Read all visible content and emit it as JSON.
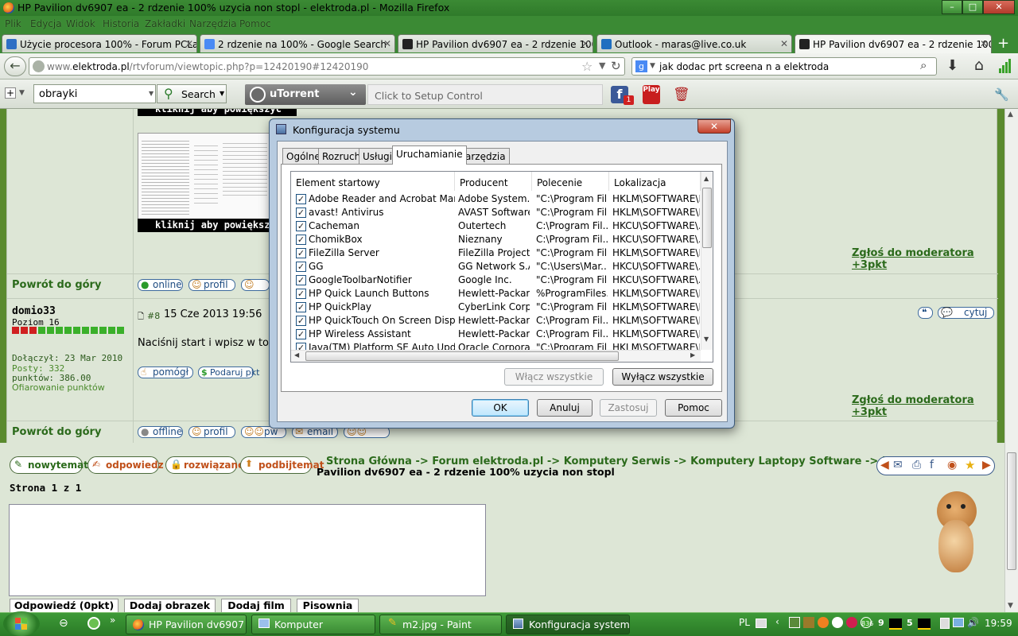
{
  "window": {
    "title": "HP Pavilion dv6907 ea - 2 rdzenie 100% uzycia non stopl - elektroda.pl - Mozilla Firefox",
    "controls": [
      "–",
      "□",
      "✕"
    ]
  },
  "menu": [
    "Plik",
    "Edycja",
    "Widok",
    "Historia",
    "Zakładki",
    "Narzędzia",
    "Pomoc"
  ],
  "tabs": [
    {
      "label": "Użycie procesora 100% - Forum PCLa...",
      "color": "#2e6fc4"
    },
    {
      "label": "2 rdzenie na 100% - Google Search",
      "color": "#4a8af4"
    },
    {
      "label": "HP Pavilion dv6907 ea - 2 rdzenie 100...",
      "color": "#222222"
    },
    {
      "label": "Outlook - maras@live.co.uk",
      "color": "#1f6fc0"
    },
    {
      "label": "HP Pavilion dv6907 ea - 2 rdzenie 100...",
      "color": "#222222"
    }
  ],
  "nav": {
    "url_prefix": "www.",
    "url_domain": "elektroda.pl",
    "url_rest": "/rtvforum/viewtopic.php?p=12420190#12420190",
    "search_value": "jak dodac prt screena n a elektroda"
  },
  "toolbar": {
    "search_field": "obrayki",
    "search_button": "Search",
    "utorrent": "uTorrent",
    "setup_control": "Click to Setup Control",
    "fb_badge": "1",
    "play_label": "Play"
  },
  "forum": {
    "thumb_caption1": "kliknij aby powiększyc",
    "thumb_caption2": "kliknij aby powiększy",
    "back_to_top": "Powrót do góry",
    "report": "Zgłoś do moderatora +3pkt",
    "btn_online": "online",
    "btn_offline": "offline",
    "btn_profile": "profil",
    "btn_pw": "pw",
    "btn_email": "email",
    "post": {
      "author": "domio33",
      "level": "Poziom 16",
      "joined": "Dołączył: 23 Mar 2010",
      "posts": "Posty: 332",
      "points": "punktów: 386.00",
      "donate_points": "Ofiarowanie punktów",
      "num": "#8",
      "date": "15 Cze 2013 19:56",
      "text": "Naciśnij start i wpisz w to p",
      "helped": "pomógł",
      "give_pts": "Podaruj pkt",
      "quote": "cytuj"
    },
    "actions": [
      "nowytemat",
      "odpowiedz",
      "rozwiązano",
      "podbijtemat"
    ],
    "breadcrumb": "Strona Główna -> Forum elektroda.pl -> Komputery Serwis -> Komputery Laptopy Software -> HP",
    "breadcrumb2": "Pavilion dv6907 ea - 2 rdzenie 100% uzycia non stopl",
    "page_info": "Strona 1 z 1",
    "reply_buttons": [
      "Odpowiedź (0pkt)",
      "Dodaj obrazek",
      "Dodaj film",
      "Pisownia"
    ]
  },
  "dialog": {
    "title": "Konfiguracja systemu",
    "tabs": [
      "Ogólne",
      "Rozruch",
      "Usługi",
      "Uruchamianie",
      "Narzędzia"
    ],
    "active_tab": "Uruchamianie",
    "columns": [
      "Element startowy",
      "Producent",
      "Polecenie",
      "Lokalizacja"
    ],
    "rows": [
      [
        "Adobe Reader and Acrobat Manager",
        "Adobe System...",
        "\"C:\\Program Fil...",
        "HKLM\\SOFTWARE\\M..."
      ],
      [
        "avast! Antivirus",
        "AVAST Software",
        "\"C:\\Program Fil...",
        "HKLM\\SOFTWARE\\M..."
      ],
      [
        "Cacheman",
        "Outertech",
        "C:\\Program Fil...",
        "HKCU\\SOFTWARE\\..."
      ],
      [
        "ChomikBox",
        "Nieznany",
        "C:\\Program Fil...",
        "HKCU\\SOFTWARE\\..."
      ],
      [
        "FileZilla Server",
        "FileZilla Project",
        "\"C:\\Program Fil...",
        "HKLM\\SOFTWARE\\M..."
      ],
      [
        "GG",
        "GG Network S.A.",
        "\"C:\\Users\\Mar...",
        "HKCU\\SOFTWARE\\..."
      ],
      [
        "GoogleToolbarNotifier",
        "Google Inc.",
        "\"C:\\Program Fil...",
        "HKCU\\SOFTWARE\\..."
      ],
      [
        "HP Quick Launch Buttons",
        "Hewlett-Packar...",
        "%ProgramFiles...",
        "HKLM\\SOFTWARE\\M..."
      ],
      [
        "HP QuickPlay",
        "CyberLink Corp.",
        "\"C:\\Program Fil...",
        "HKLM\\SOFTWARE\\M..."
      ],
      [
        "HP QuickTouch On Screen Display",
        "Hewlett-Packar...",
        "C:\\Program Fil...",
        "HKLM\\SOFTWARE\\M..."
      ],
      [
        "HP Wireless Assistant",
        "Hewlett-Packar...",
        "C:\\Program Fil...",
        "HKLM\\SOFTWARE\\M..."
      ],
      [
        "Java(TM) Platform SE Auto Updater",
        "Oracle Corpora...",
        "\"C:\\Program Fil...",
        "HKLM\\SOFTWARE\\M..."
      ]
    ],
    "enable_all": "Włącz wszystkie",
    "disable_all": "Wyłącz wszystkie",
    "ok": "OK",
    "cancel": "Anuluj",
    "apply": "Zastosuj",
    "help": "Pomoc"
  },
  "taskbar": {
    "items": [
      "HP Pavilion dv6907 ...",
      "Komputer",
      "m2.jpg - Paint",
      "Konfiguracja systemu"
    ],
    "lang": "PL",
    "tray_num1": "9",
    "tray_num2": "5",
    "tray_small": "836",
    "clock": "19:59"
  }
}
